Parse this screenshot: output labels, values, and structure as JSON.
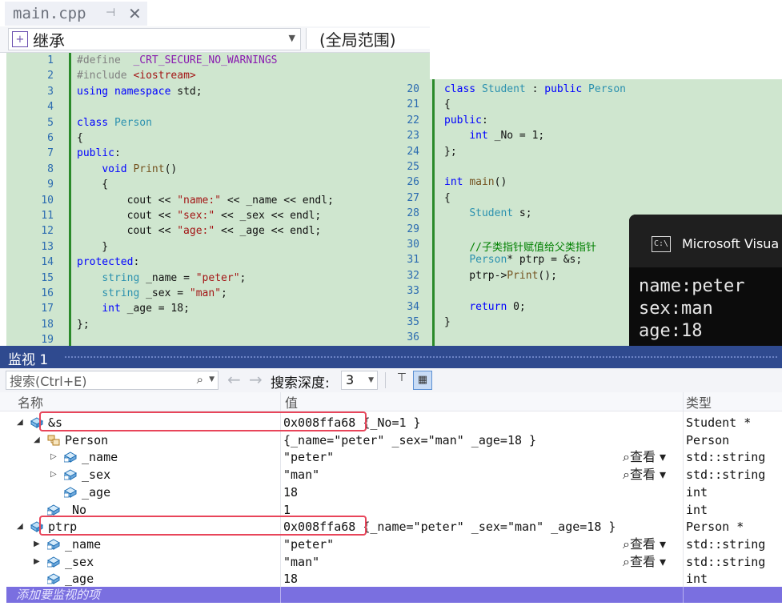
{
  "editor": {
    "tab_title": "main.cpp",
    "pin_glyph": "⊣",
    "close_glyph": "✕",
    "scope_dropdown": "继承",
    "global_dropdown": "(全局范围)",
    "left_lines": [
      {
        "n": "1",
        "html": "<span class=\"pp\">#define</span>  <span class=\"mac\">_CRT_SECURE_NO_WARNINGS</span>"
      },
      {
        "n": "2",
        "html": "<span class=\"pp\">#include</span> <span class=\"str\">&lt;iostream&gt;</span>"
      },
      {
        "n": "3",
        "html": "<span class=\"kw\">using</span> <span class=\"kw\">namespace</span> std;"
      },
      {
        "n": "4",
        "html": ""
      },
      {
        "n": "5",
        "html": "<span class=\"kw\">class</span> <span class=\"ty\">Person</span>"
      },
      {
        "n": "6",
        "html": "{"
      },
      {
        "n": "7",
        "html": "<span class=\"kw\">public</span>:"
      },
      {
        "n": "8",
        "html": "    <span class=\"kw\">void</span> <span class=\"fn\">Print</span>()"
      },
      {
        "n": "9",
        "html": "    {"
      },
      {
        "n": "10",
        "html": "        cout &lt;&lt; <span class=\"str\">\"name:\"</span> &lt;&lt; _name &lt;&lt; endl;"
      },
      {
        "n": "11",
        "html": "        cout &lt;&lt; <span class=\"str\">\"sex:\"</span> &lt;&lt; _sex &lt;&lt; endl;"
      },
      {
        "n": "12",
        "html": "        cout &lt;&lt; <span class=\"str\">\"age:\"</span> &lt;&lt; _age &lt;&lt; endl;"
      },
      {
        "n": "13",
        "html": "    }"
      },
      {
        "n": "14",
        "html": "<span class=\"kw\">protected</span>:"
      },
      {
        "n": "15",
        "html": "    <span class=\"ty\">string</span> _name = <span class=\"str\">\"peter\"</span>;"
      },
      {
        "n": "16",
        "html": "    <span class=\"ty\">string</span> _sex = <span class=\"str\">\"man\"</span>;"
      },
      {
        "n": "17",
        "html": "    <span class=\"kw\">int</span> _age = 18;"
      },
      {
        "n": "18",
        "html": "};"
      },
      {
        "n": "19",
        "html": ""
      }
    ],
    "right_lines": [
      {
        "n": "20",
        "html": "<span class=\"kw\">class</span> <span class=\"ty\">Student</span> : <span class=\"kw\">public</span> <span class=\"ty\">Person</span>"
      },
      {
        "n": "21",
        "html": "{"
      },
      {
        "n": "22",
        "html": "<span class=\"kw\">public</span>:"
      },
      {
        "n": "23",
        "html": "    <span class=\"kw\">int</span> _No = 1;"
      },
      {
        "n": "24",
        "html": "};"
      },
      {
        "n": "25",
        "html": ""
      },
      {
        "n": "26",
        "html": "<span class=\"kw\">int</span> <span class=\"fn\">main</span>()"
      },
      {
        "n": "27",
        "html": "{"
      },
      {
        "n": "28",
        "html": "    <span class=\"ty\">Student</span> s;"
      },
      {
        "n": "29",
        "html": ""
      },
      {
        "n": "30",
        "html": "    <span class=\"cm\">//子类指针赋值给父类指针</span>"
      },
      {
        "n": "31",
        "html": "    <span class=\"ty\">Person</span>* ptrp = &amp;s;"
      },
      {
        "n": "32",
        "html": "    ptrp-&gt;<span class=\"fn\">Print</span>();"
      },
      {
        "n": "33",
        "html": ""
      },
      {
        "n": "34",
        "html": "    <span class=\"kw\">return</span> 0;"
      },
      {
        "n": "35",
        "html": "}"
      },
      {
        "n": "36",
        "html": ""
      }
    ]
  },
  "console": {
    "title": "Microsoft Visua",
    "icon_text": "C:\\",
    "output": [
      "name:peter",
      "sex:man",
      "age:18"
    ]
  },
  "watch": {
    "title": "监视 1",
    "search_placeholder": "搜索(Ctrl+E)",
    "search_icon": "⌕",
    "back_arrow": "←",
    "forward_arrow": "→",
    "depth_label": "搜索深度:",
    "depth_value": "3",
    "columns": {
      "name": "名称",
      "value": "值",
      "type": "类型"
    },
    "view_label": "查看",
    "add_item": "添加要监视的项",
    "rows": [
      {
        "name": "&s",
        "value": "0x008ffa68 {_No=1 }",
        "type": "Student *",
        "indent": 0,
        "expander": "◢",
        "icon": "object",
        "highlight": true
      },
      {
        "name": "Person",
        "value": "{_name=\"peter\" _sex=\"man\" _age=18 }",
        "type": "Person",
        "indent": 1,
        "expander": "◢",
        "icon": "base",
        "highlight": false
      },
      {
        "name": "_name",
        "value": "\"peter\"",
        "type": "std::string",
        "indent": 2,
        "expander": "▷",
        "icon": "field",
        "view": true,
        "highlight": false
      },
      {
        "name": "_sex",
        "value": "\"man\"",
        "type": "std::string",
        "indent": 2,
        "expander": "▷",
        "icon": "field",
        "view": true,
        "highlight": false
      },
      {
        "name": "_age",
        "value": "18",
        "type": "int",
        "indent": 2,
        "expander": "",
        "icon": "field",
        "highlight": false
      },
      {
        "name": "_No",
        "value": "1",
        "type": "int",
        "indent": 1,
        "expander": "",
        "icon": "field",
        "highlight": false
      },
      {
        "name": "ptrp",
        "value": "0x008ffa68 {_name=\"peter\" _sex=\"man\" _age=18 }",
        "type": "Person *",
        "indent": 0,
        "expander": "◢",
        "icon": "object",
        "highlight": true
      },
      {
        "name": "_name",
        "value": "\"peter\"",
        "type": "std::string",
        "indent": 1,
        "expander": "▶",
        "icon": "field",
        "view": true,
        "highlight": false
      },
      {
        "name": "_sex",
        "value": "\"man\"",
        "type": "std::string",
        "indent": 1,
        "expander": "▶",
        "icon": "field",
        "view": true,
        "highlight": false
      },
      {
        "name": "_age",
        "value": "18",
        "type": "int",
        "indent": 1,
        "expander": "",
        "icon": "field",
        "highlight": false
      }
    ]
  },
  "colors": {
    "accent": "#2f4a8f",
    "highlight_border": "#e8455a",
    "add_row": "#7a6fe0",
    "code_bg": "#cfe6cf"
  }
}
